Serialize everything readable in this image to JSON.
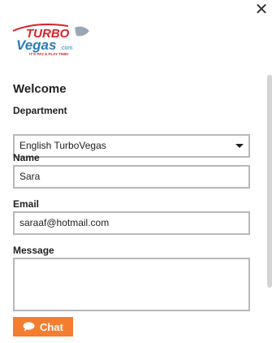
{
  "brand": {
    "logo_top": "TURBO",
    "logo_bottom": "Vegas",
    "logo_suffix": ".com",
    "tagline": "IT'S PAY & PLAY TIME!"
  },
  "form": {
    "welcome": "Welcome",
    "department": {
      "label": "Department",
      "value": "English TurboVegas"
    },
    "name": {
      "label": "Name",
      "value": "Sara"
    },
    "email": {
      "label": "Email",
      "value": "saraaf@hotmail.com"
    },
    "message": {
      "label": "Message",
      "value": ""
    }
  },
  "actions": {
    "chat_label": "Chat"
  },
  "colors": {
    "accent": "#f47d30",
    "logo_red": "#d8232a",
    "logo_blue": "#2a7ab8"
  }
}
